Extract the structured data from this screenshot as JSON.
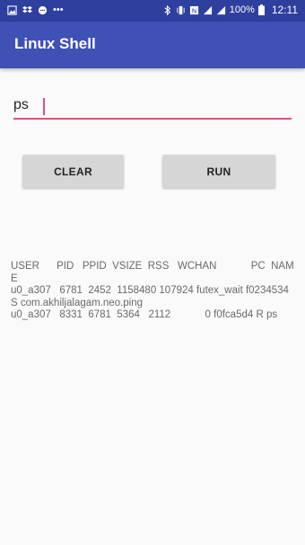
{
  "status_bar": {
    "battery": "100%",
    "time": "12:11"
  },
  "app_bar": {
    "title": "Linux Shell"
  },
  "command_input": {
    "value": "ps"
  },
  "buttons": {
    "clear_label": "CLEAR",
    "run_label": "RUN"
  },
  "output": {
    "text": "USER      PID   PPID  VSIZE  RSS   WCHAN            PC  NAME\nu0_a307   6781  2452  1158480 107924 futex_wait f0234534 S com.akhiljalagam.neo.ping\nu0_a307   8331  6781  5364   2112            0 f0fca5d4 R ps"
  }
}
